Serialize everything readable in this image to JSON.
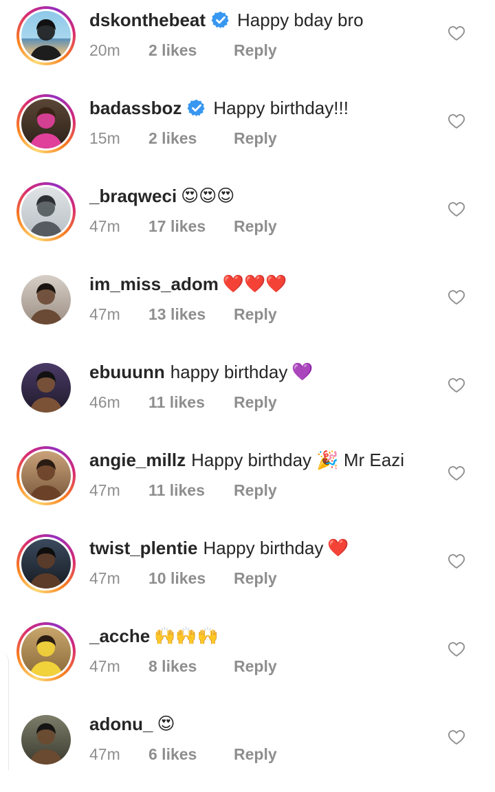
{
  "comments": [
    {
      "username": "dskonthebeat",
      "verified": true,
      "message": "Happy bday bro",
      "emoji": "",
      "time": "20m",
      "likes": "2 likes",
      "reply": "Reply",
      "story_ring": true
    },
    {
      "username": "badassboz",
      "verified": true,
      "message": "Happy birthday!!!",
      "emoji": "",
      "time": "15m",
      "likes": "2 likes",
      "reply": "Reply",
      "story_ring": true
    },
    {
      "username": "_braqweci",
      "verified": false,
      "message": "",
      "emoji": "😍😍😍",
      "time": "47m",
      "likes": "17 likes",
      "reply": "Reply",
      "story_ring": true
    },
    {
      "username": "im_miss_adom",
      "verified": false,
      "message": "",
      "emoji": "❤️❤️❤️",
      "time": "47m",
      "likes": "13 likes",
      "reply": "Reply",
      "story_ring": false
    },
    {
      "username": "ebuuunn",
      "verified": false,
      "message": "happy birthday",
      "emoji": "💜",
      "time": "46m",
      "likes": "11 likes",
      "reply": "Reply",
      "story_ring": false
    },
    {
      "username": "angie_millz",
      "verified": false,
      "message": "Happy birthday 🎉 Mr Eazi",
      "emoji": "",
      "time": "47m",
      "likes": "11 likes",
      "reply": "Reply",
      "story_ring": true
    },
    {
      "username": "twist_plentie",
      "verified": false,
      "message": "Happy birthday",
      "emoji": "❤️",
      "time": "47m",
      "likes": "10 likes",
      "reply": "Reply",
      "story_ring": true
    },
    {
      "username": "_acche",
      "verified": false,
      "message": "",
      "emoji": "🙌🙌🙌",
      "time": "47m",
      "likes": "8 likes",
      "reply": "Reply",
      "story_ring": true
    },
    {
      "username": "adonu_",
      "verified": false,
      "message": "",
      "emoji": "😍",
      "time": "47m",
      "likes": "6 likes",
      "reply": "Reply",
      "story_ring": false
    }
  ],
  "colors": {
    "text": "#262626",
    "meta": "#8e8e8e",
    "verified": "#3897f0"
  },
  "icons": {
    "verified": "verified-badge-icon",
    "like": "heart-outline-icon"
  }
}
